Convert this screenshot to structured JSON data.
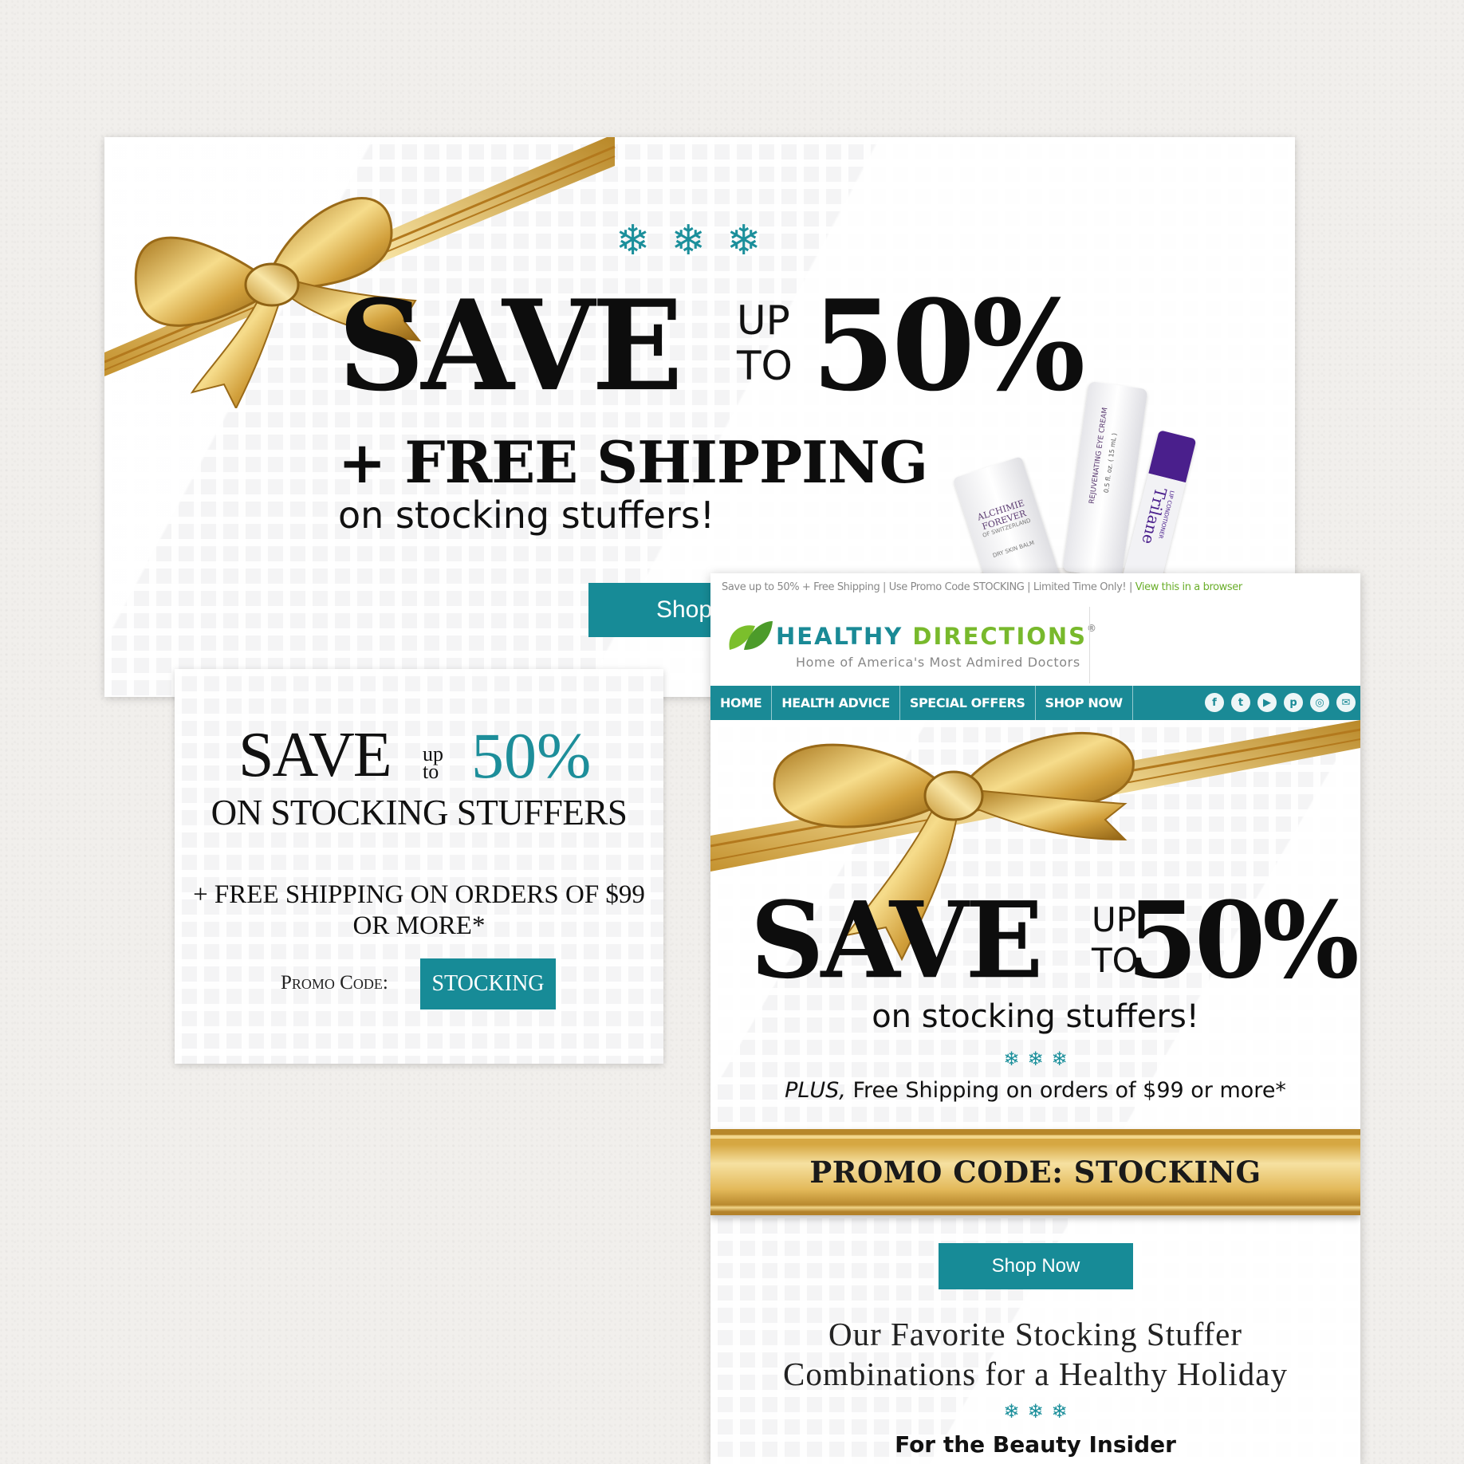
{
  "colors": {
    "teal": "#1b8f9b",
    "gold": "#d4a23b",
    "nav": "#1a8a96"
  },
  "banner": {
    "snowflakes": [
      "❄",
      "❄",
      "❄"
    ],
    "save": "SAVE",
    "up": "UP",
    "to": "TO",
    "percent": "50%",
    "free_shipping": "+ FREE SHIPPING",
    "subtitle": "on stocking stuffers!",
    "shop_button": "Shop",
    "products": [
      "ALCHIMIE FOREVER",
      "OF SWITZERLAND",
      "DRY SKIN BALM",
      "REJUVENATING EYE CREAM",
      "0.5 fl. oz. ( 15 mL )",
      "Trilane",
      "LIP CONDITIONER"
    ]
  },
  "square_ad": {
    "save": "SAVE",
    "up": "up",
    "to": "to",
    "percent": "50%",
    "on_stocking": "ON STOCKING STUFFERS",
    "free_shipping_line1": "+ FREE SHIPPING ON ORDERS OF $99",
    "free_shipping_line2": "OR MORE*",
    "promo_label": "Promo Code:",
    "promo_code": "STOCKING"
  },
  "email": {
    "preheader": "Save up to 50% + Free Shipping | Use Promo Code STOCKING | Limited Time Only! |",
    "view_browser": "View this in a browser",
    "brand_healthy": "HEALTHY",
    "brand_directions": "DIRECTIONS",
    "brand_reg": "®",
    "tagline": "Home of America's Most Admired Doctors",
    "nav": [
      "HOME",
      "HEALTH ADVICE",
      "SPECIAL OFFERS",
      "SHOP NOW"
    ],
    "social_icons": [
      "facebook-icon",
      "twitter-icon",
      "youtube-icon",
      "pinterest-icon",
      "instagram-icon",
      "email-icon"
    ],
    "social_glyphs": [
      "f",
      "t",
      "▶",
      "p",
      "◎",
      "✉"
    ],
    "save": "SAVE",
    "up": "UP",
    "to": "TO",
    "percent": "50%",
    "subtitle": "on stocking stuffers!",
    "snowflakes": [
      "❄",
      "❄",
      "❄"
    ],
    "plus": "PLUS,",
    "plus_rest": " Free Shipping on orders of $99 or more*",
    "promo_banner": "PROMO CODE: STOCKING",
    "shop_now": "Shop Now",
    "favorites_line1": "Our Favorite Stocking Stuffer",
    "favorites_line2": "Combinations for a Healthy Holiday",
    "snowflakes2": [
      "❄",
      "❄",
      "❄"
    ],
    "beauty_insider": "For the Beauty Insider"
  }
}
